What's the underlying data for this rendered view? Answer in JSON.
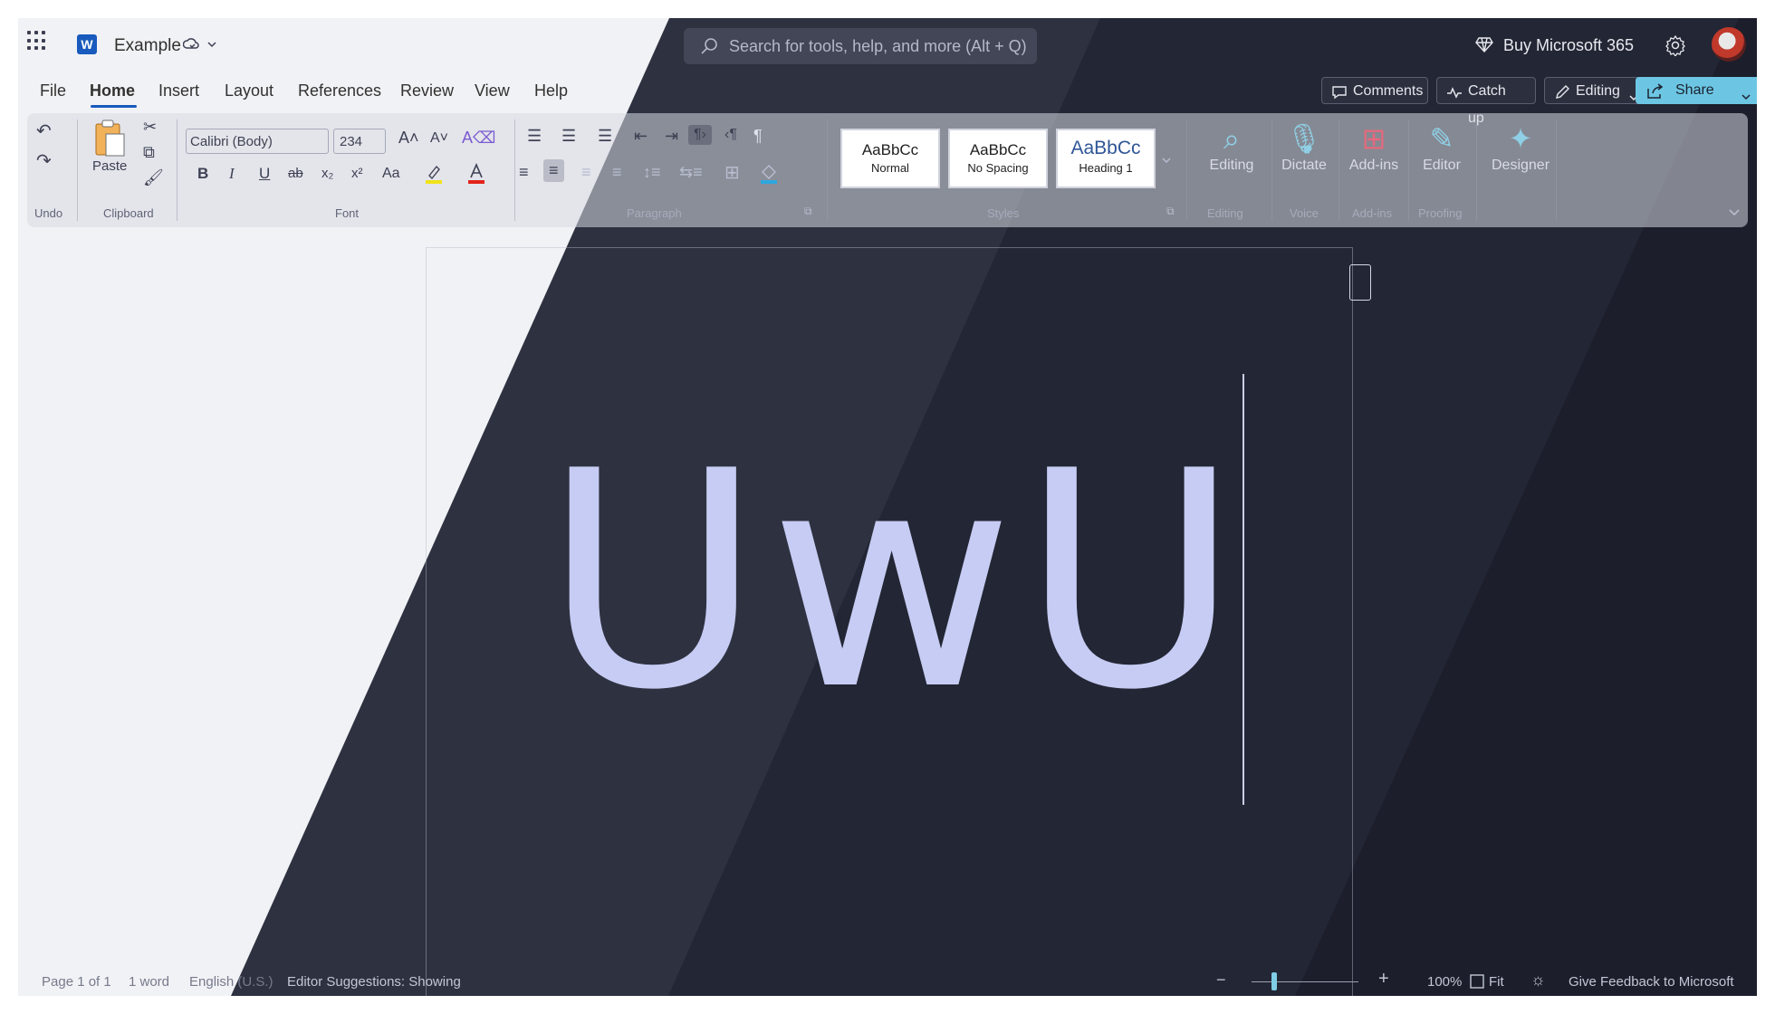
{
  "titlebar": {
    "doc_name": "Example",
    "search_placeholder": "Search for tools, help, and more (Alt + Q)",
    "buy_label": "Buy Microsoft 365",
    "logo_letter": "W"
  },
  "menu": {
    "items": [
      "File",
      "Home",
      "Insert",
      "Layout",
      "References",
      "Review",
      "View",
      "Help"
    ],
    "active": "Home",
    "comments_label": "Comments",
    "catchup_label": "Catch up",
    "editing_label": "Editing",
    "share_label": "Share"
  },
  "ribbon": {
    "undo_label": "Undo",
    "clipboard_group": "Clipboard",
    "paste_label": "Paste",
    "font_name": "Calibri (Body)",
    "font_size": "234",
    "font_group": "Font",
    "paragraph_group": "Paragraph",
    "styles": [
      {
        "preview": "AaBbCc",
        "name": "Normal"
      },
      {
        "preview": "AaBbCc",
        "name": "No Spacing"
      },
      {
        "preview": "AaBbCc",
        "name": "Heading 1"
      }
    ],
    "styles_group": "Styles",
    "editing_btn": "Editing",
    "editing_group": "Editing",
    "dictate_btn": "Dictate",
    "voice_group": "Voice",
    "addins_btn": "Add-ins",
    "addins_group": "Add-ins",
    "editor_btn": "Editor",
    "proofing_group": "Proofing",
    "designer_btn": "Designer",
    "font_btns": {
      "bold": "B",
      "italic": "I",
      "underline": "U",
      "strike": "ab",
      "sub": "x₂",
      "sup": "x²",
      "case": "Aa"
    }
  },
  "document": {
    "text": "UwU"
  },
  "status": {
    "page": "Page 1 of 1",
    "words": "1 word",
    "language": "English (U.S.)",
    "suggestions": "Editor Suggestions: Showing",
    "zoom": "100%",
    "fit": "Fit",
    "feedback": "Give Feedback to Microsoft",
    "zoom_value": 100
  },
  "colors": {
    "accent": "#185abd",
    "share": "#6cc6e3",
    "text_glyph": "#c6ccf3"
  }
}
